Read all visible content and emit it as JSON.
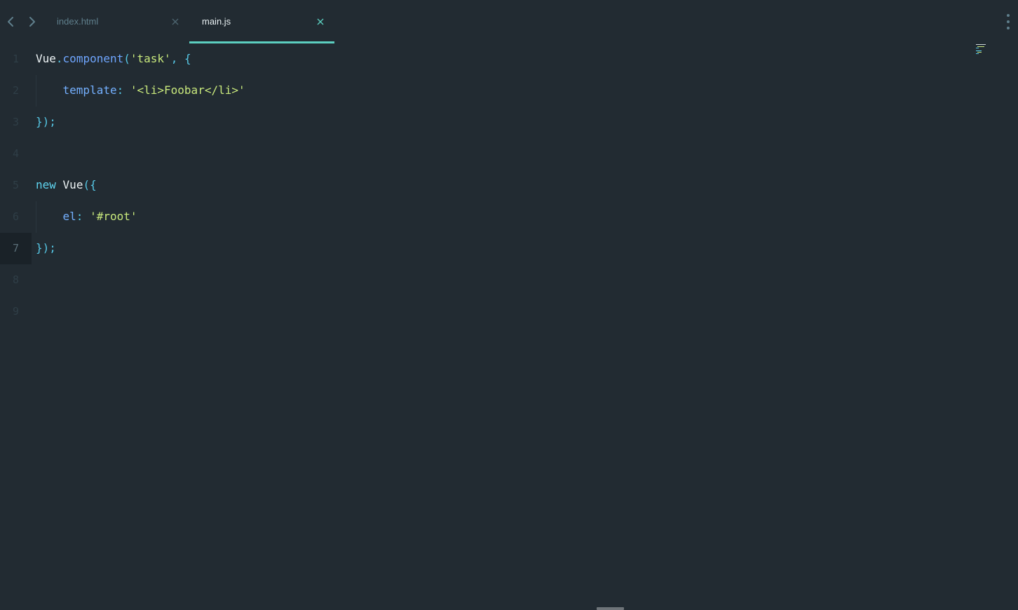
{
  "tabs": [
    {
      "label": "index.html",
      "active": false
    },
    {
      "label": "main.js",
      "active": true
    }
  ],
  "navigation": {
    "back_icon": "chevron-left-icon",
    "forward_icon": "chevron-right-icon",
    "more_icon": "vertical-ellipsis-icon"
  },
  "editor": {
    "active_line": 7,
    "lines": [
      {
        "number": "1",
        "tokens": [
          {
            "text": "Vue",
            "type": "obj"
          },
          {
            "text": ".",
            "type": "punc"
          },
          {
            "text": "component",
            "type": "fn"
          },
          {
            "text": "(",
            "type": "punc"
          },
          {
            "text": "'task'",
            "type": "str"
          },
          {
            "text": ", {",
            "type": "punc"
          }
        ]
      },
      {
        "number": "2",
        "indent": true,
        "tokens": [
          {
            "text": "    ",
            "type": "obj"
          },
          {
            "text": "template",
            "type": "prop"
          },
          {
            "text": ": ",
            "type": "punc"
          },
          {
            "text": "'<li>Foobar</li>'",
            "type": "str"
          }
        ]
      },
      {
        "number": "3",
        "tokens": [
          {
            "text": "});",
            "type": "punc"
          }
        ]
      },
      {
        "number": "4",
        "tokens": []
      },
      {
        "number": "5",
        "tokens": [
          {
            "text": "new",
            "type": "kw"
          },
          {
            "text": " ",
            "type": "obj"
          },
          {
            "text": "Vue",
            "type": "obj"
          },
          {
            "text": "({",
            "type": "punc"
          }
        ]
      },
      {
        "number": "6",
        "indent": true,
        "tokens": [
          {
            "text": "    ",
            "type": "obj"
          },
          {
            "text": "el",
            "type": "prop"
          },
          {
            "text": ": ",
            "type": "punc"
          },
          {
            "text": "'#root'",
            "type": "str"
          }
        ]
      },
      {
        "number": "7",
        "tokens": [
          {
            "text": "});",
            "type": "punc"
          }
        ]
      },
      {
        "number": "8",
        "tokens": []
      },
      {
        "number": "9",
        "tokens": []
      }
    ]
  },
  "colors": {
    "background": "#222b32",
    "accent": "#5ccfc0",
    "string": "#c8e87c",
    "keyword": "#5fd4ef",
    "function": "#6fa6ff"
  }
}
